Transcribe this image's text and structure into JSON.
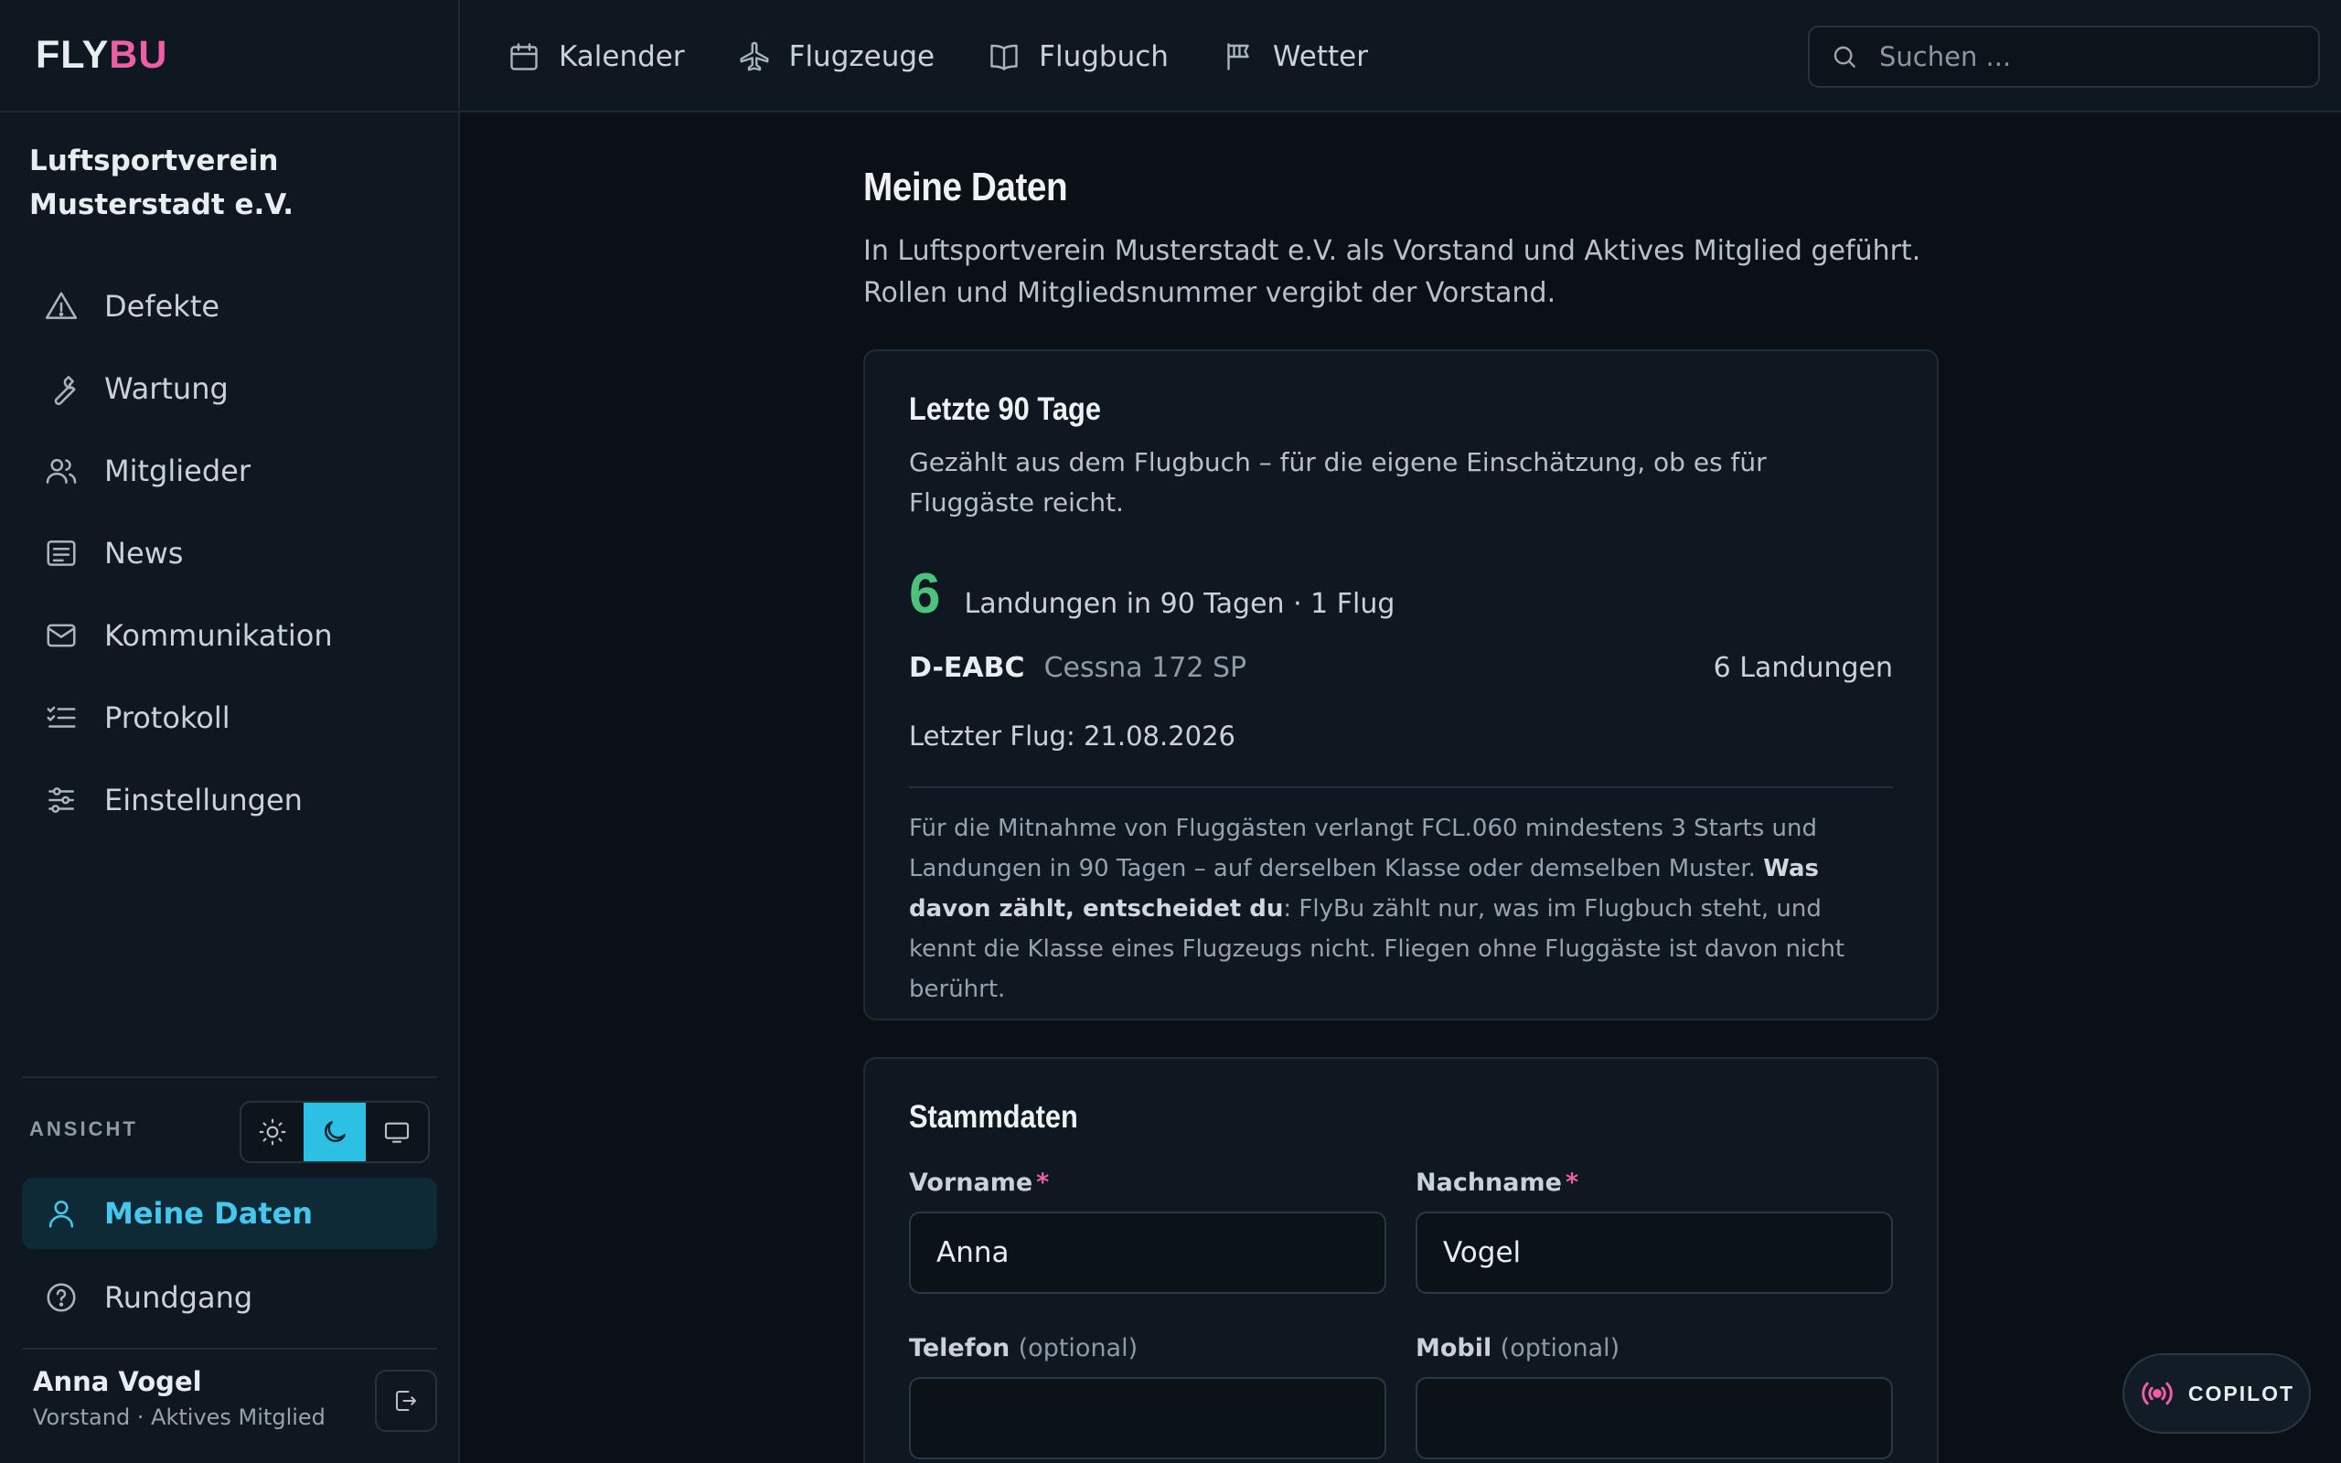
{
  "logo": {
    "part1": "FLY",
    "part2": "BU"
  },
  "org_name": "Luftsportverein Musterstadt e.V.",
  "sidebar": {
    "items": [
      {
        "label": "Defekte",
        "icon": "warning-icon"
      },
      {
        "label": "Wartung",
        "icon": "wrench-icon"
      },
      {
        "label": "Mitglieder",
        "icon": "users-icon"
      },
      {
        "label": "News",
        "icon": "news-icon"
      },
      {
        "label": "Kommunikation",
        "icon": "mail-icon"
      },
      {
        "label": "Protokoll",
        "icon": "list-icon"
      },
      {
        "label": "Einstellungen",
        "icon": "sliders-icon"
      }
    ],
    "view_label": "ANSICHT",
    "theme_active": "dark",
    "my_data_label": "Meine Daten",
    "tour_label": "Rundgang",
    "user_name": "Anna Vogel",
    "user_role": "Vorstand · Aktives Mitglied"
  },
  "topnav": [
    {
      "label": "Kalender",
      "icon": "calendar-icon"
    },
    {
      "label": "Flugzeuge",
      "icon": "plane-icon"
    },
    {
      "label": "Flugbuch",
      "icon": "book-icon"
    },
    {
      "label": "Wetter",
      "icon": "flag-icon"
    }
  ],
  "search": {
    "placeholder": "Suchen ..."
  },
  "page": {
    "title": "Meine Daten",
    "intro": "In Luftsportverein Musterstadt e.V. als Vorstand und Aktives Mitglied geführt. Rollen und Mitgliedsnummer vergibt der Vorstand."
  },
  "recency": {
    "title": "Letzte 90 Tage",
    "subtitle": "Gezählt aus dem Flugbuch – für die eigene Einschätzung, ob es für Fluggäste reicht.",
    "landings_count": "6",
    "landings_text": "Landungen in 90 Tagen · 1 Flug",
    "aircraft_reg": "D-EABC",
    "aircraft_type": "Cessna 172 SP",
    "aircraft_landings": "6 Landungen",
    "last_flight": "Letzter Flug: 21.08.2026",
    "rule_part1": "Für die Mitnahme von Fluggästen verlangt FCL.060 mindestens 3 Starts und Landungen in 90 Tagen – auf derselben Klasse oder demselben Muster. ",
    "rule_bold": "Was davon zählt, entscheidet du",
    "rule_part2": ": FlyBu zählt nur, was im Flugbuch steht, und kennt die Klasse eines Flugzeugs nicht. Fliegen ohne Fluggäste ist davon nicht berührt.",
    "accent_color": "#4cc27c"
  },
  "master_data": {
    "title": "Stammdaten",
    "first_name_label": "Vorname",
    "first_name_value": "Anna",
    "last_name_label": "Nachname",
    "last_name_value": "Vogel",
    "required_mark": "*",
    "phone_label": "Telefon",
    "mobile_label": "Mobil",
    "optional_text": "(optional)"
  },
  "copilot": {
    "label": "COPILOT"
  }
}
